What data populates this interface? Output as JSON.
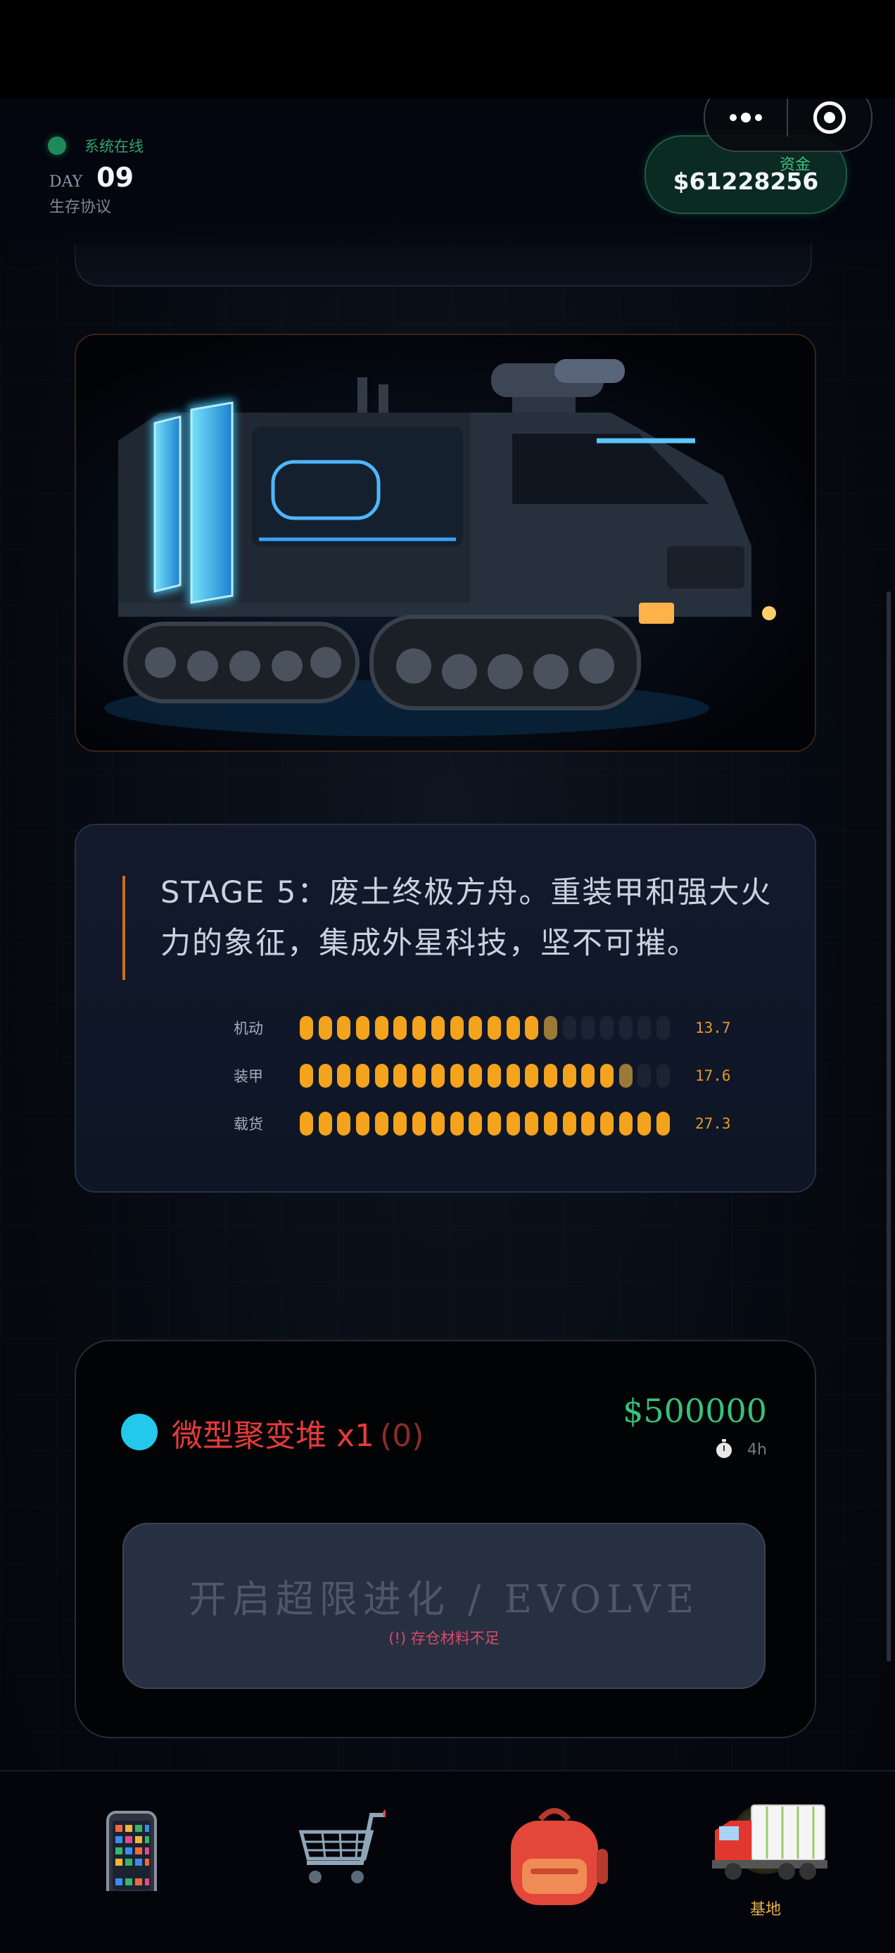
{
  "status": {
    "text": "系统在线",
    "color": "#1f8a59"
  },
  "day": {
    "label": "DAY",
    "value": "09",
    "subtitle": "生存协议"
  },
  "capsule": {
    "more_icon": "more-dots-icon",
    "close_icon": "target-icon"
  },
  "funds": {
    "label": "资金",
    "value": "$61228256"
  },
  "vehicle": {
    "image_alt": "armored tracked truck with glowing blue shields"
  },
  "stage": {
    "text": "STAGE 5：废土终极方舟。重装甲和强大火力的象征，集成外星科技，坚不可摧。",
    "stats": [
      {
        "label": "机动",
        "value": "13.7",
        "filled": 13.7
      },
      {
        "label": "装甲",
        "value": "17.6",
        "filled": 17.6
      },
      {
        "label": "载货",
        "value": "27.3",
        "filled": 20
      }
    ],
    "max_pips": 20
  },
  "material": {
    "name": "微型聚变堆 x1",
    "owned": "(0)",
    "cost": "$500000",
    "time": "4h"
  },
  "evolve": {
    "label": "开启超限进化 / EVOLVE",
    "warning": "(!) 存仓材料不足"
  },
  "tabs": [
    {
      "icon": "phone-icon",
      "label": ""
    },
    {
      "icon": "cart-icon",
      "label": ""
    },
    {
      "icon": "backpack-icon",
      "label": ""
    },
    {
      "icon": "truck-icon",
      "label": "基地",
      "active": true
    }
  ],
  "colors": {
    "accent": "#f4a31d",
    "danger": "#e53a3a",
    "money": "#36c27b",
    "cyan": "#22c9ea"
  }
}
